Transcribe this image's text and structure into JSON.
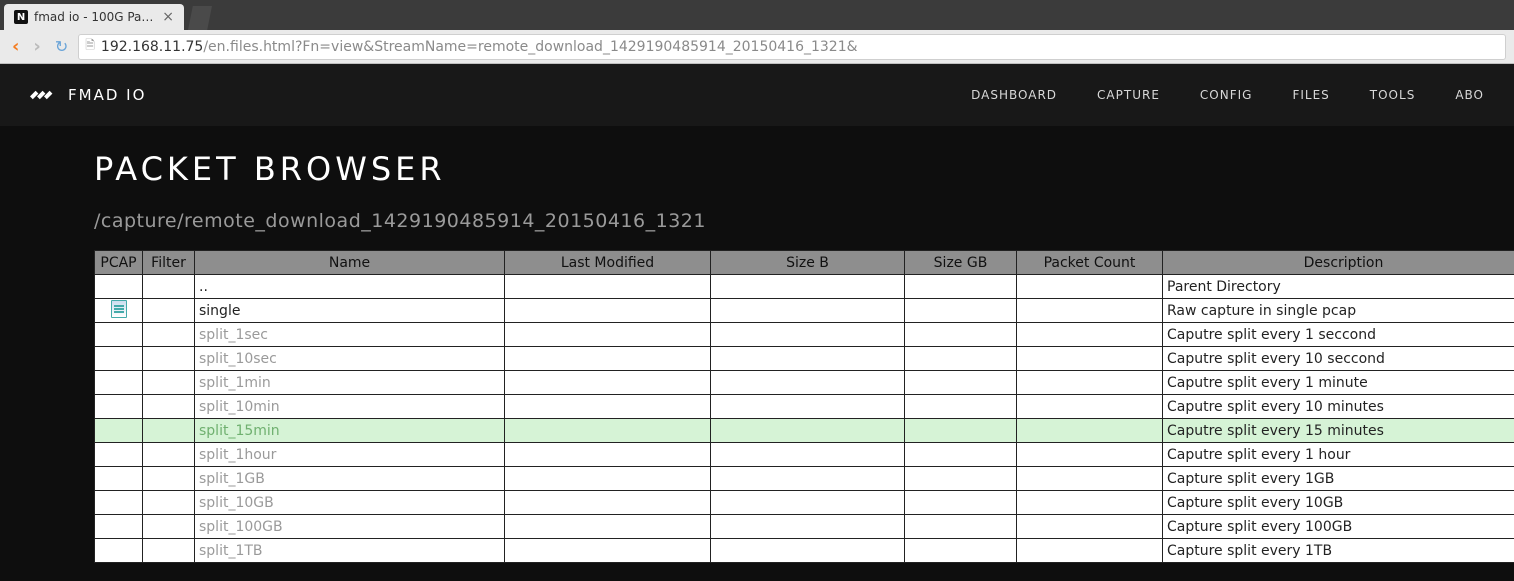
{
  "browser": {
    "tab_title": "fmad io - 100G Pa…",
    "url_host": "192.168.11.75",
    "url_path": "/en.files.html?Fn=view&StreamName=remote_download_1429190485914_20150416_1321&"
  },
  "brand": "FMAD IO",
  "nav": [
    "DASHBOARD",
    "CAPTURE",
    "CONFIG",
    "FILES",
    "TOOLS",
    "ABO"
  ],
  "page_title": "PACKET BROWSER",
  "subpath": "/capture/remote_download_1429190485914_20150416_1321",
  "columns": [
    "PCAP",
    "Filter",
    "Name",
    "Last Modified",
    "Size B",
    "Size GB",
    "Packet Count",
    "Description"
  ],
  "rows": [
    {
      "icon": false,
      "name": "..",
      "muted": false,
      "desc": "Parent Directory",
      "hl": false
    },
    {
      "icon": true,
      "name": "single",
      "muted": false,
      "desc": "Raw capture in single pcap",
      "hl": false
    },
    {
      "icon": false,
      "name": "split_1sec",
      "muted": true,
      "desc": "Caputre split every 1 seccond",
      "hl": false
    },
    {
      "icon": false,
      "name": "split_10sec",
      "muted": true,
      "desc": "Caputre split every 10 seccond",
      "hl": false
    },
    {
      "icon": false,
      "name": "split_1min",
      "muted": true,
      "desc": "Caputre split every 1 minute",
      "hl": false
    },
    {
      "icon": false,
      "name": "split_10min",
      "muted": true,
      "desc": "Caputre split every 10 minutes",
      "hl": false
    },
    {
      "icon": false,
      "name": "split_15min",
      "muted": true,
      "desc": "Caputre split every 15 minutes",
      "hl": true
    },
    {
      "icon": false,
      "name": "split_1hour",
      "muted": true,
      "desc": "Caputre split every 1 hour",
      "hl": false
    },
    {
      "icon": false,
      "name": "split_1GB",
      "muted": true,
      "desc": "Capture split every 1GB",
      "hl": false
    },
    {
      "icon": false,
      "name": "split_10GB",
      "muted": true,
      "desc": "Capture split every 10GB",
      "hl": false
    },
    {
      "icon": false,
      "name": "split_100GB",
      "muted": true,
      "desc": "Capture split every 100GB",
      "hl": false
    },
    {
      "icon": false,
      "name": "split_1TB",
      "muted": true,
      "desc": "Capture split every 1TB",
      "hl": false
    }
  ]
}
